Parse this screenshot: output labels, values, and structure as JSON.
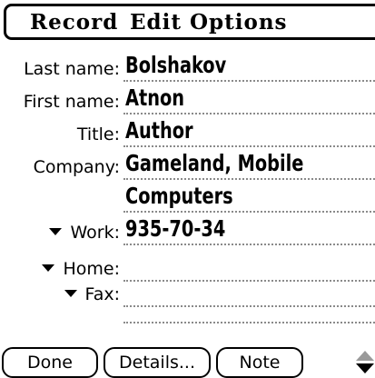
{
  "menu": {
    "record": "Record",
    "edit": "Edit",
    "options": "Options"
  },
  "fields": {
    "last_name": {
      "label": "Last name:",
      "value": "Bolshakov"
    },
    "first_name": {
      "label": "First name:",
      "value": "Atnon"
    },
    "title": {
      "label": "Title:",
      "value": "Author"
    },
    "company": {
      "label": "Company:",
      "value_line1": "Gameland, Mobile",
      "value_line2": "Computers"
    },
    "work": {
      "label": "Work:",
      "value": "935-70-34"
    },
    "home": {
      "label": "Home:",
      "value": ""
    },
    "fax": {
      "label": "Fax:",
      "value": ""
    }
  },
  "buttons": {
    "done": "Done",
    "details": "Details...",
    "note": "Note"
  },
  "icons": {
    "dropdown": "triangle-down-icon",
    "scroll": "scroll-arrows-icon"
  }
}
